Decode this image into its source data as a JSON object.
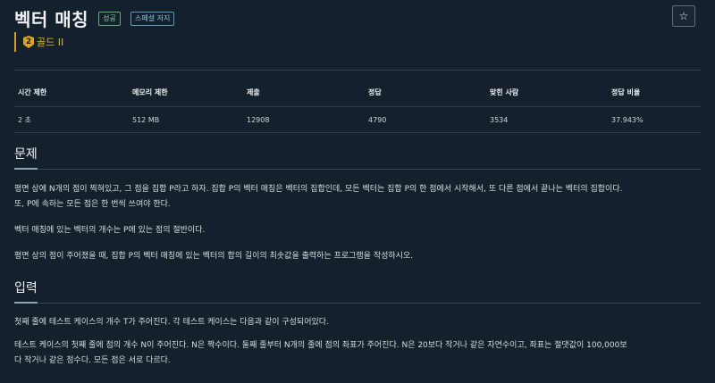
{
  "problem": {
    "title": "벡터 매칭",
    "labels": [
      "성공",
      "스페셜 저지"
    ],
    "tier": "골드 II",
    "tier_badge": "2",
    "star": "☆"
  },
  "info_table": {
    "headers": [
      "시간 제한",
      "메모리 제한",
      "제출",
      "정답",
      "맞힌 사람",
      "정답 비율"
    ],
    "values": [
      "2 초",
      "512 MB",
      "12908",
      "4790",
      "3534",
      "37.943%"
    ]
  },
  "sections": {
    "problem_title": "문제",
    "problem_paragraphs": [
      "평면 상에 N개의 점이 찍혀있고, 그 점을 집합 P라고 하자. 집합 P의 벡터 매칭은 벡터의 집합인데, 모든 벡터는 집합 P의 한 점에서 시작해서, 또 다른 점에서 끝나는 벡터의 집합이다.",
      "또, P에 속하는 모든 점은 한 번씩 쓰여야 한다.",
      "벡터 매칭에 있는 벡터의 개수는 P에 있는 점의 절반이다.",
      "평면 상의 점이 주어졌을 때, 집합 P의 벡터 매칭에 있는 벡터의 합의 길이의 최솟값을 출력하는 프로그램을 작성하시오."
    ],
    "input_title": "입력",
    "input_paragraphs": [
      "첫째 줄에 테스트 케이스의 개수 T가 주어진다. 각 테스트 케이스는 다음과 같이 구성되어있다.",
      "테스트 케이스의 첫째 줄에 점의 개수 N이 주어진다. N은 짝수이다. 둘째 줄부터 N개의 줄에 점의 좌표가 주어진다. N은 20보다 작거나 같은 자연수이고, 좌표는 절댓값이 100,000보",
      "다 작거나 같은 정수다. 모든 점은 서로 다르다."
    ]
  },
  "colors": {
    "background": "#14202b",
    "tier_gold": "#e5b534",
    "label_success": "#7fd19a",
    "label_info": "#8ac6e6"
  },
  "icons": {
    "tier": "gold-tier-badge-icon",
    "star": "star-outline-icon"
  }
}
